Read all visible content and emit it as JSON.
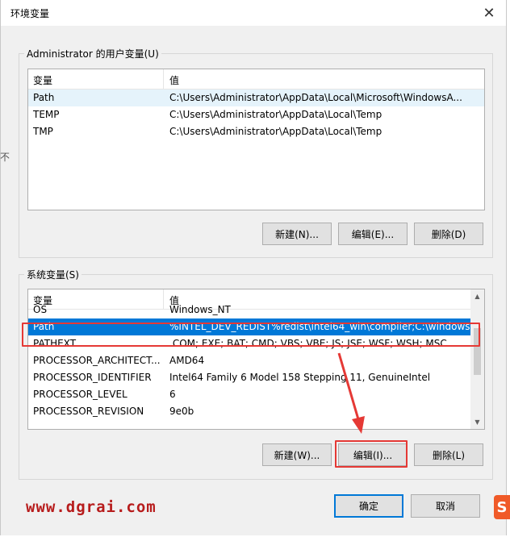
{
  "window": {
    "title": "环境变量"
  },
  "user_vars": {
    "label": "Administrator 的用户变量(U)",
    "columns": [
      "变量",
      "值"
    ],
    "rows": [
      {
        "name": "Path",
        "value": "C:\\Users\\Administrator\\AppData\\Local\\Microsoft\\WindowsA..."
      },
      {
        "name": "TEMP",
        "value": "C:\\Users\\Administrator\\AppData\\Local\\Temp"
      },
      {
        "name": "TMP",
        "value": "C:\\Users\\Administrator\\AppData\\Local\\Temp"
      }
    ],
    "buttons": {
      "new": "新建(N)...",
      "edit": "编辑(E)...",
      "delete": "删除(D)"
    }
  },
  "system_vars": {
    "label": "系统变量(S)",
    "columns": [
      "变量",
      "值"
    ],
    "rows": [
      {
        "name": "OS",
        "value": "Windows_NT"
      },
      {
        "name": "Path",
        "value": "%INTEL_DEV_REDIST%redist\\intel64_win\\compiler;C:\\windows..."
      },
      {
        "name": "PATHEXT",
        "value": ".COM;.EXE;.BAT;.CMD;.VBS;.VBE;.JS;.JSE;.WSF;.WSH;.MSC"
      },
      {
        "name": "PROCESSOR_ARCHITECT...",
        "value": "AMD64"
      },
      {
        "name": "PROCESSOR_IDENTIFIER",
        "value": "Intel64 Family 6 Model 158 Stepping 11, GenuineIntel"
      },
      {
        "name": "PROCESSOR_LEVEL",
        "value": "6"
      },
      {
        "name": "PROCESSOR_REVISION",
        "value": "9e0b"
      }
    ],
    "buttons": {
      "new": "新建(W)...",
      "edit": "编辑(I)...",
      "delete": "删除(L)"
    }
  },
  "footer": {
    "ok": "确定",
    "cancel": "取消"
  },
  "watermark": "www.dgrai.com",
  "edge_text": "不",
  "logo_text": "S",
  "colors": {
    "selection": "#0078d7",
    "highlight": "#e53935",
    "watermark": "#b71c1c"
  }
}
